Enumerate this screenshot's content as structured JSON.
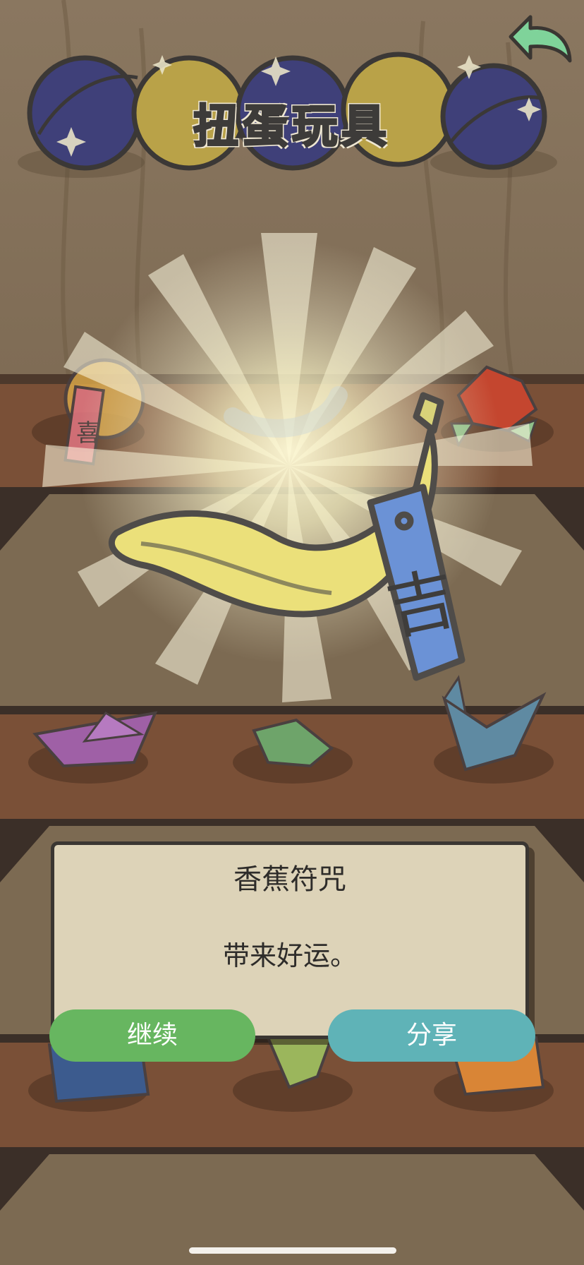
{
  "header": {
    "title": "扭蛋玩具"
  },
  "back_button": {
    "icon": "back-arrow-icon"
  },
  "prize": {
    "name": "香蕉符咒",
    "description": "带来好运。",
    "charm_char": "吉"
  },
  "shelf_items": [
    {
      "name": "orange-charm",
      "char": "喜"
    },
    {
      "name": "banana-charm-small"
    },
    {
      "name": "origami-rose"
    },
    {
      "name": "origami-boat"
    },
    {
      "name": "origami-frog"
    },
    {
      "name": "origami-crane"
    },
    {
      "name": "origami-blue"
    },
    {
      "name": "origami-green"
    },
    {
      "name": "origami-orange"
    }
  ],
  "actions": {
    "continue_label": "继续",
    "share_label": "分享"
  },
  "colors": {
    "continue_button": "#67b660",
    "share_button": "#5fb3b7",
    "dialog_bg": "#ddd3b8",
    "capsule_blue": "#3f4079",
    "capsule_yellow": "#b9a248",
    "back_arrow": "#7fd39a"
  }
}
